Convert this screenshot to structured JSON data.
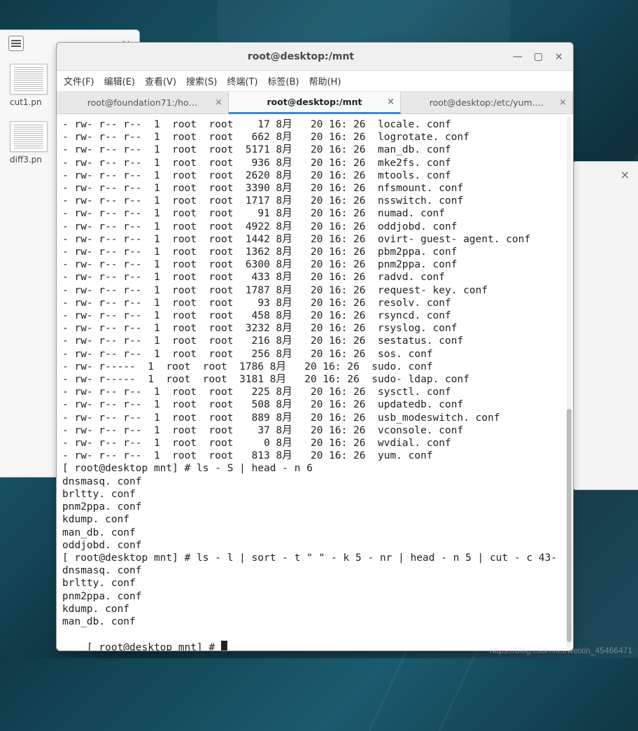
{
  "fm": {
    "thumbs": [
      {
        "label": "cut1.pn"
      },
      {
        "label": "diff3.pn"
      }
    ]
  },
  "right": {
    "close": "×"
  },
  "term": {
    "title": "root@desktop:/mnt",
    "menu": [
      "文件(F)",
      "编辑(E)",
      "查看(V)",
      "搜索(S)",
      "终端(T)",
      "标签(B)",
      "帮助(H)"
    ],
    "tabs": [
      {
        "label": "root@foundation71:/ho…",
        "active": false
      },
      {
        "label": "root@desktop:/mnt",
        "active": true
      },
      {
        "label": "root@desktop:/etc/yum.…",
        "active": false
      }
    ],
    "rows": [
      {
        "perm": "- rw- r-- r--",
        "l": "1",
        "o": "root",
        "g": "root",
        "sz": "17",
        "m": "8月",
        "d": "20",
        "t": "16: 26",
        "n": "locale. conf"
      },
      {
        "perm": "- rw- r-- r--",
        "l": "1",
        "o": "root",
        "g": "root",
        "sz": "662",
        "m": "8月",
        "d": "20",
        "t": "16: 26",
        "n": "logrotate. conf"
      },
      {
        "perm": "- rw- r-- r--",
        "l": "1",
        "o": "root",
        "g": "root",
        "sz": "5171",
        "m": "8月",
        "d": "20",
        "t": "16: 26",
        "n": "man_db. conf"
      },
      {
        "perm": "- rw- r-- r--",
        "l": "1",
        "o": "root",
        "g": "root",
        "sz": "936",
        "m": "8月",
        "d": "20",
        "t": "16: 26",
        "n": "mke2fs. conf"
      },
      {
        "perm": "- rw- r-- r--",
        "l": "1",
        "o": "root",
        "g": "root",
        "sz": "2620",
        "m": "8月",
        "d": "20",
        "t": "16: 26",
        "n": "mtools. conf"
      },
      {
        "perm": "- rw- r-- r--",
        "l": "1",
        "o": "root",
        "g": "root",
        "sz": "3390",
        "m": "8月",
        "d": "20",
        "t": "16: 26",
        "n": "nfsmount. conf"
      },
      {
        "perm": "- rw- r-- r--",
        "l": "1",
        "o": "root",
        "g": "root",
        "sz": "1717",
        "m": "8月",
        "d": "20",
        "t": "16: 26",
        "n": "nsswitch. conf"
      },
      {
        "perm": "- rw- r-- r--",
        "l": "1",
        "o": "root",
        "g": "root",
        "sz": "91",
        "m": "8月",
        "d": "20",
        "t": "16: 26",
        "n": "numad. conf"
      },
      {
        "perm": "- rw- r-- r--",
        "l": "1",
        "o": "root",
        "g": "root",
        "sz": "4922",
        "m": "8月",
        "d": "20",
        "t": "16: 26",
        "n": "oddjobd. conf"
      },
      {
        "perm": "- rw- r-- r--",
        "l": "1",
        "o": "root",
        "g": "root",
        "sz": "1442",
        "m": "8月",
        "d": "20",
        "t": "16: 26",
        "n": "ovirt- guest- agent. conf"
      },
      {
        "perm": "- rw- r-- r--",
        "l": "1",
        "o": "root",
        "g": "root",
        "sz": "1362",
        "m": "8月",
        "d": "20",
        "t": "16: 26",
        "n": "pbm2ppa. conf"
      },
      {
        "perm": "- rw- r-- r--",
        "l": "1",
        "o": "root",
        "g": "root",
        "sz": "6300",
        "m": "8月",
        "d": "20",
        "t": "16: 26",
        "n": "pnm2ppa. conf"
      },
      {
        "perm": "- rw- r-- r--",
        "l": "1",
        "o": "root",
        "g": "root",
        "sz": "433",
        "m": "8月",
        "d": "20",
        "t": "16: 26",
        "n": "radvd. conf"
      },
      {
        "perm": "- rw- r-- r--",
        "l": "1",
        "o": "root",
        "g": "root",
        "sz": "1787",
        "m": "8月",
        "d": "20",
        "t": "16: 26",
        "n": "request- key. conf"
      },
      {
        "perm": "- rw- r-- r--",
        "l": "1",
        "o": "root",
        "g": "root",
        "sz": "93",
        "m": "8月",
        "d": "20",
        "t": "16: 26",
        "n": "resolv. conf"
      },
      {
        "perm": "- rw- r-- r--",
        "l": "1",
        "o": "root",
        "g": "root",
        "sz": "458",
        "m": "8月",
        "d": "20",
        "t": "16: 26",
        "n": "rsyncd. conf"
      },
      {
        "perm": "- rw- r-- r--",
        "l": "1",
        "o": "root",
        "g": "root",
        "sz": "3232",
        "m": "8月",
        "d": "20",
        "t": "16: 26",
        "n": "rsyslog. conf"
      },
      {
        "perm": "- rw- r-- r--",
        "l": "1",
        "o": "root",
        "g": "root",
        "sz": "216",
        "m": "8月",
        "d": "20",
        "t": "16: 26",
        "n": "sestatus. conf"
      },
      {
        "perm": "- rw- r-- r--",
        "l": "1",
        "o": "root",
        "g": "root",
        "sz": "256",
        "m": "8月",
        "d": "20",
        "t": "16: 26",
        "n": "sos. conf"
      },
      {
        "perm": "- rw- r-----",
        "l": "1",
        "o": "root",
        "g": "root",
        "sz": "1786",
        "m": "8月",
        "d": "20",
        "t": "16: 26",
        "n": "sudo. conf"
      },
      {
        "perm": "- rw- r-----",
        "l": "1",
        "o": "root",
        "g": "root",
        "sz": "3181",
        "m": "8月",
        "d": "20",
        "t": "16: 26",
        "n": "sudo- ldap. conf"
      },
      {
        "perm": "- rw- r-- r--",
        "l": "1",
        "o": "root",
        "g": "root",
        "sz": "225",
        "m": "8月",
        "d": "20",
        "t": "16: 26",
        "n": "sysctl. conf"
      },
      {
        "perm": "- rw- r-- r--",
        "l": "1",
        "o": "root",
        "g": "root",
        "sz": "508",
        "m": "8月",
        "d": "20",
        "t": "16: 26",
        "n": "updatedb. conf"
      },
      {
        "perm": "- rw- r-- r--",
        "l": "1",
        "o": "root",
        "g": "root",
        "sz": "889",
        "m": "8月",
        "d": "20",
        "t": "16: 26",
        "n": "usb_modeswitch. conf"
      },
      {
        "perm": "- rw- r-- r--",
        "l": "1",
        "o": "root",
        "g": "root",
        "sz": "37",
        "m": "8月",
        "d": "20",
        "t": "16: 26",
        "n": "vconsole. conf"
      },
      {
        "perm": "- rw- r-- r--",
        "l": "1",
        "o": "root",
        "g": "root",
        "sz": "0",
        "m": "8月",
        "d": "20",
        "t": "16: 26",
        "n": "wvdial. conf"
      },
      {
        "perm": "- rw- r-- r--",
        "l": "1",
        "o": "root",
        "g": "root",
        "sz": "813",
        "m": "8月",
        "d": "20",
        "t": "16: 26",
        "n": "yum. conf"
      }
    ],
    "prompt1": "[ root@desktop mnt] # ls - S | head - n 6",
    "out1": [
      "dnsmasq. conf",
      "brltty. conf",
      "pnm2ppa. conf",
      "kdump. conf",
      "man_db. conf",
      "oddjobd. conf"
    ],
    "prompt2": "[ root@desktop mnt] # ls - l | sort - t \" \" - k 5 - nr | head - n 5 | cut - c 43-",
    "out2": [
      "dnsmasq. conf",
      "brltty. conf",
      "pnm2ppa. conf",
      "kdump. conf",
      "man_db. conf"
    ],
    "prompt3": "[ root@desktop mnt] # "
  },
  "watermark": "https://blog.csdn.net/weixin_45466471"
}
